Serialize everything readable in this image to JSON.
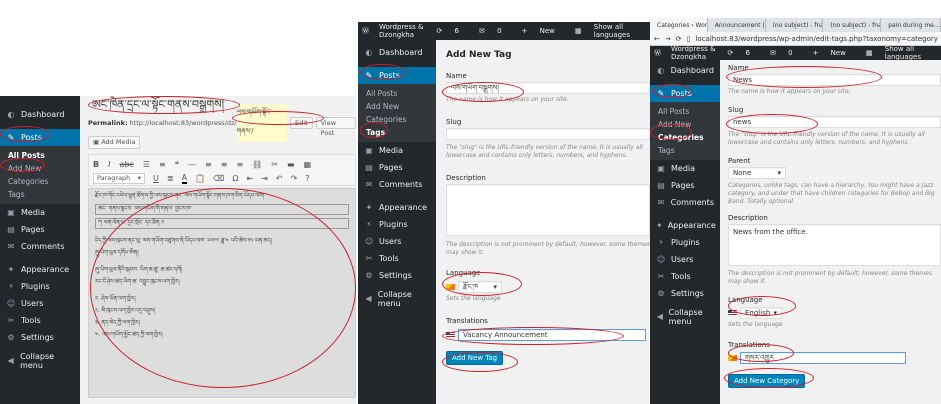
{
  "panel1": {
    "sidebar": [
      {
        "label": "Dashboard",
        "icon": "dashboard-icon",
        "glyph": "◐"
      },
      {
        "label": "Posts",
        "icon": "pin-icon",
        "glyph": "✎",
        "active": true
      },
      {
        "label": "Media",
        "icon": "media-icon",
        "glyph": "▣"
      },
      {
        "label": "Pages",
        "icon": "pages-icon",
        "glyph": "▤"
      },
      {
        "label": "Comments",
        "icon": "comments-icon",
        "glyph": "✉"
      },
      {
        "label": "Appearance",
        "icon": "appearance-icon",
        "glyph": "✦"
      },
      {
        "label": "Plugins",
        "icon": "plugins-icon",
        "glyph": "⚡"
      },
      {
        "label": "Users",
        "icon": "users-icon",
        "glyph": "☺"
      },
      {
        "label": "Tools",
        "icon": "tools-icon",
        "glyph": "✂"
      },
      {
        "label": "Settings",
        "icon": "settings-icon",
        "glyph": "⚙"
      },
      {
        "label": "Collapse menu",
        "icon": "collapse-icon",
        "glyph": "◀"
      }
    ],
    "posts_sub": [
      "All Posts",
      "Add New",
      "Categories",
      "Tags"
    ],
    "title": "ཨང་ཁེན་དྲང་ལ་སྟོང་གནས་བསྒྲགས།",
    "permalink_label": "Permalink:",
    "permalink_url": "http://localhost:83/wordpress/dz/",
    "permalink_slug": "ལས་གཡོག་སྟོང་གནས་/",
    "edit_btn": "Edit",
    "view_btn": "View Post",
    "add_media": "Add Media",
    "format_select": "Paragraph",
    "body_lines": [
      "རྫོང་ཁ་གོང་འཕེལ་ལྷན་ཚོགས་ཀྱི་ལས་ཁུངས་ནང་ ལས་གཡོག་སྟོང་གནས་ཁག་ཅིག་ཡོདཔ་ལས།",
      "ཨང་    གནས་སྟངས་        ལས་གཡོག་གི་གནས་      གྱངས་ཁ་",
      "ཀ     ལག་ལེན་པ་          དྲང་སྲོང་ དང་ཐིག    ༡",
      "ངེད་ཀྱི་ལས་ཁུངས་ནང་ལུ་ ལས་གཡོག་བཙུགས་ནི་ཡོདཔ་ལས་ ༢༠༡༧ ཟླ་༤ པའི་ཚེས་༡༥ ཡན་ཆད།",
      "ཞུ་ཡིག་ཕུལ་དགོཔ་ཨིན།",
      "ཞུ་ཡིག་ཕུལ་ནིའི་སྐབས་ ཡིག་ཆ་ཚུ་ ཆ་ཚང་དགོ།",
      "རང་ངོ་ཤེས་ཚད་ཡིག་ཆ་ འབྱུང་ཁུངས་ལག་ཁྱེར།",
      "༡. ཤེས་ཡོན་ལག་ཁྱེར།",
      "༢. མི་ཁུངས་ལག་ཁྱེར་འདྲ་བཤུས།",
      "༣. ནད་མེད་ཀྱི་ལག་ཁྱེར།",
      "༤. ལས་གཡོག་མྱོང་ཚད་ཀྱི་ལག་ཁྱེར།"
    ]
  },
  "panel2": {
    "adminbar": {
      "site": "Wordpress & Dzongkha",
      "updates": "6",
      "comments": "0",
      "new": "New",
      "languages": "Show all languages"
    },
    "sidebar": [
      {
        "label": "Dashboard",
        "icon": "dashboard-icon",
        "glyph": "◐"
      },
      {
        "label": "Posts",
        "icon": "pin-icon",
        "glyph": "✎",
        "active": true
      },
      {
        "label": "Media",
        "icon": "media-icon",
        "glyph": "▣"
      },
      {
        "label": "Pages",
        "icon": "pages-icon",
        "glyph": "▤"
      },
      {
        "label": "Comments",
        "icon": "comments-icon",
        "glyph": "✉"
      },
      {
        "label": "Appearance",
        "icon": "appearance-icon",
        "glyph": "✦"
      },
      {
        "label": "Plugins",
        "icon": "plugins-icon",
        "glyph": "⚡"
      },
      {
        "label": "Users",
        "icon": "users-icon",
        "glyph": "☺"
      },
      {
        "label": "Tools",
        "icon": "tools-icon",
        "glyph": "✂"
      },
      {
        "label": "Settings",
        "icon": "settings-icon",
        "glyph": "⚙"
      },
      {
        "label": "Collapse menu",
        "icon": "collapse-icon",
        "glyph": "◀"
      }
    ],
    "posts_sub": [
      "All Posts",
      "Add New",
      "Categories",
      "Tags"
    ],
    "heading": "Add New Tag",
    "name_label": "Name",
    "name_value": "ལས་གཡོག་བསྒྲགས།",
    "name_help": "The name is how it appears on your site.",
    "slug_label": "Slug",
    "slug_help": "The \"slug\" is the URL-friendly version of the name. It is usually all lowercase and contains only letters, numbers, and hyphens.",
    "desc_label": "Description",
    "desc_help": "The description is not prominent by default; however, some themes may show it.",
    "lang_label": "Language",
    "lang_value": "རྫོང་ཁ",
    "lang_help": "Sets the language",
    "trans_label": "Translations",
    "trans_value": "Vacancy Announcement",
    "submit": "Add New Tag"
  },
  "panel3": {
    "tabs": [
      {
        "label": "Categories ‹ Word…",
        "color": "#d33"
      },
      {
        "label": "Announcement | c…",
        "color": "#d33"
      },
      {
        "label": "(no subject) - fnan…",
        "color": "#d33"
      },
      {
        "label": "(no subject) - fnan…",
        "color": "#d33"
      },
      {
        "label": "pain during me…",
        "color": "#4a8"
      }
    ],
    "url": "localhost:83/wordpress/wp-admin/edit-tags.php?taxonomy=category",
    "adminbar": {
      "site": "Wordpress & Dzongkha",
      "updates": "6",
      "comments": "0",
      "new": "New",
      "languages": "Show all languages"
    },
    "sidebar": [
      {
        "label": "Dashboard",
        "icon": "dashboard-icon",
        "glyph": "◐"
      },
      {
        "label": "Posts",
        "icon": "pin-icon",
        "glyph": "✎",
        "active": true
      },
      {
        "label": "Media",
        "icon": "media-icon",
        "glyph": "▣"
      },
      {
        "label": "Pages",
        "icon": "pages-icon",
        "glyph": "▤"
      },
      {
        "label": "Comments",
        "icon": "comments-icon",
        "glyph": "✉"
      },
      {
        "label": "Appearance",
        "icon": "appearance-icon",
        "glyph": "✦"
      },
      {
        "label": "Plugins",
        "icon": "plugins-icon",
        "glyph": "⚡"
      },
      {
        "label": "Users",
        "icon": "users-icon",
        "glyph": "☺"
      },
      {
        "label": "Tools",
        "icon": "tools-icon",
        "glyph": "✂"
      },
      {
        "label": "Settings",
        "icon": "settings-icon",
        "glyph": "⚙"
      },
      {
        "label": "Collapse menu",
        "icon": "collapse-icon",
        "glyph": "◀"
      }
    ],
    "posts_sub": [
      "All Posts",
      "Add New",
      "Categories",
      "Tags"
    ],
    "name_label": "Name",
    "name_value": "News",
    "name_help": "The name is how it appears on your site.",
    "slug_label": "Slug",
    "slug_value": "news",
    "slug_help": "The \"slug\" is the URL-friendly version of the name. It is usually all lowercase and contains only letters, numbers, and hyphens.",
    "parent_label": "Parent",
    "parent_value": "None",
    "parent_help": "Categories, unlike tags, can have a hierarchy. You might have a Jazz category, and under that have children categories for Bebop and Big Band. Totally optional.",
    "desc_label": "Description",
    "desc_value": "News from the office.",
    "desc_help": "The description is not prominent by default; however, some themes may show it.",
    "lang_label": "Language",
    "lang_value": "English",
    "lang_help": "Sets the language",
    "trans_label": "Translations",
    "trans_value": "གསར་འགྱུར",
    "submit": "Add New Category"
  }
}
